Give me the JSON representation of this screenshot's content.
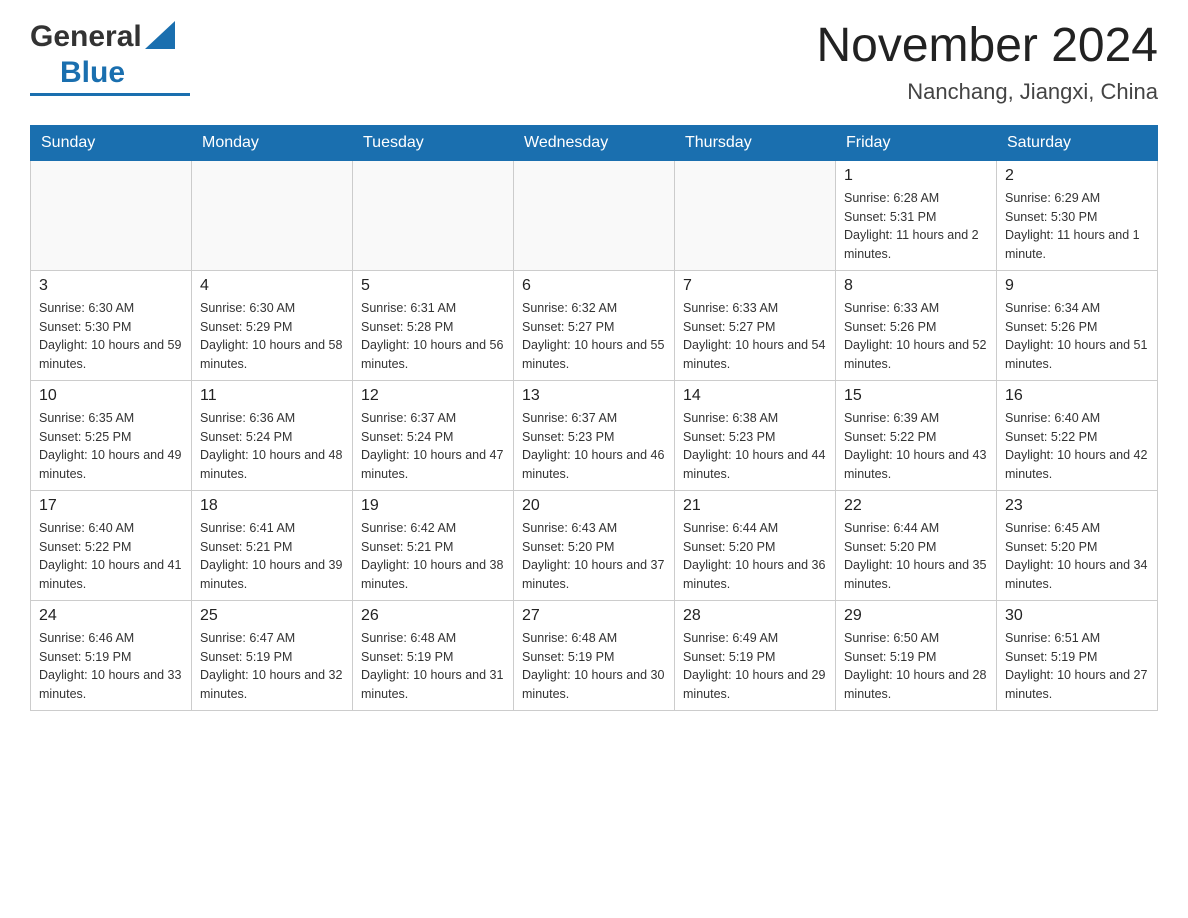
{
  "header": {
    "month_title": "November 2024",
    "location": "Nanchang, Jiangxi, China",
    "logo_general": "General",
    "logo_blue": "Blue"
  },
  "days_of_week": [
    "Sunday",
    "Monday",
    "Tuesday",
    "Wednesday",
    "Thursday",
    "Friday",
    "Saturday"
  ],
  "weeks": [
    [
      {
        "day": "",
        "sunrise": "",
        "sunset": "",
        "daylight": ""
      },
      {
        "day": "",
        "sunrise": "",
        "sunset": "",
        "daylight": ""
      },
      {
        "day": "",
        "sunrise": "",
        "sunset": "",
        "daylight": ""
      },
      {
        "day": "",
        "sunrise": "",
        "sunset": "",
        "daylight": ""
      },
      {
        "day": "",
        "sunrise": "",
        "sunset": "",
        "daylight": ""
      },
      {
        "day": "1",
        "sunrise": "Sunrise: 6:28 AM",
        "sunset": "Sunset: 5:31 PM",
        "daylight": "Daylight: 11 hours and 2 minutes."
      },
      {
        "day": "2",
        "sunrise": "Sunrise: 6:29 AM",
        "sunset": "Sunset: 5:30 PM",
        "daylight": "Daylight: 11 hours and 1 minute."
      }
    ],
    [
      {
        "day": "3",
        "sunrise": "Sunrise: 6:30 AM",
        "sunset": "Sunset: 5:30 PM",
        "daylight": "Daylight: 10 hours and 59 minutes."
      },
      {
        "day": "4",
        "sunrise": "Sunrise: 6:30 AM",
        "sunset": "Sunset: 5:29 PM",
        "daylight": "Daylight: 10 hours and 58 minutes."
      },
      {
        "day": "5",
        "sunrise": "Sunrise: 6:31 AM",
        "sunset": "Sunset: 5:28 PM",
        "daylight": "Daylight: 10 hours and 56 minutes."
      },
      {
        "day": "6",
        "sunrise": "Sunrise: 6:32 AM",
        "sunset": "Sunset: 5:27 PM",
        "daylight": "Daylight: 10 hours and 55 minutes."
      },
      {
        "day": "7",
        "sunrise": "Sunrise: 6:33 AM",
        "sunset": "Sunset: 5:27 PM",
        "daylight": "Daylight: 10 hours and 54 minutes."
      },
      {
        "day": "8",
        "sunrise": "Sunrise: 6:33 AM",
        "sunset": "Sunset: 5:26 PM",
        "daylight": "Daylight: 10 hours and 52 minutes."
      },
      {
        "day": "9",
        "sunrise": "Sunrise: 6:34 AM",
        "sunset": "Sunset: 5:26 PM",
        "daylight": "Daylight: 10 hours and 51 minutes."
      }
    ],
    [
      {
        "day": "10",
        "sunrise": "Sunrise: 6:35 AM",
        "sunset": "Sunset: 5:25 PM",
        "daylight": "Daylight: 10 hours and 49 minutes."
      },
      {
        "day": "11",
        "sunrise": "Sunrise: 6:36 AM",
        "sunset": "Sunset: 5:24 PM",
        "daylight": "Daylight: 10 hours and 48 minutes."
      },
      {
        "day": "12",
        "sunrise": "Sunrise: 6:37 AM",
        "sunset": "Sunset: 5:24 PM",
        "daylight": "Daylight: 10 hours and 47 minutes."
      },
      {
        "day": "13",
        "sunrise": "Sunrise: 6:37 AM",
        "sunset": "Sunset: 5:23 PM",
        "daylight": "Daylight: 10 hours and 46 minutes."
      },
      {
        "day": "14",
        "sunrise": "Sunrise: 6:38 AM",
        "sunset": "Sunset: 5:23 PM",
        "daylight": "Daylight: 10 hours and 44 minutes."
      },
      {
        "day": "15",
        "sunrise": "Sunrise: 6:39 AM",
        "sunset": "Sunset: 5:22 PM",
        "daylight": "Daylight: 10 hours and 43 minutes."
      },
      {
        "day": "16",
        "sunrise": "Sunrise: 6:40 AM",
        "sunset": "Sunset: 5:22 PM",
        "daylight": "Daylight: 10 hours and 42 minutes."
      }
    ],
    [
      {
        "day": "17",
        "sunrise": "Sunrise: 6:40 AM",
        "sunset": "Sunset: 5:22 PM",
        "daylight": "Daylight: 10 hours and 41 minutes."
      },
      {
        "day": "18",
        "sunrise": "Sunrise: 6:41 AM",
        "sunset": "Sunset: 5:21 PM",
        "daylight": "Daylight: 10 hours and 39 minutes."
      },
      {
        "day": "19",
        "sunrise": "Sunrise: 6:42 AM",
        "sunset": "Sunset: 5:21 PM",
        "daylight": "Daylight: 10 hours and 38 minutes."
      },
      {
        "day": "20",
        "sunrise": "Sunrise: 6:43 AM",
        "sunset": "Sunset: 5:20 PM",
        "daylight": "Daylight: 10 hours and 37 minutes."
      },
      {
        "day": "21",
        "sunrise": "Sunrise: 6:44 AM",
        "sunset": "Sunset: 5:20 PM",
        "daylight": "Daylight: 10 hours and 36 minutes."
      },
      {
        "day": "22",
        "sunrise": "Sunrise: 6:44 AM",
        "sunset": "Sunset: 5:20 PM",
        "daylight": "Daylight: 10 hours and 35 minutes."
      },
      {
        "day": "23",
        "sunrise": "Sunrise: 6:45 AM",
        "sunset": "Sunset: 5:20 PM",
        "daylight": "Daylight: 10 hours and 34 minutes."
      }
    ],
    [
      {
        "day": "24",
        "sunrise": "Sunrise: 6:46 AM",
        "sunset": "Sunset: 5:19 PM",
        "daylight": "Daylight: 10 hours and 33 minutes."
      },
      {
        "day": "25",
        "sunrise": "Sunrise: 6:47 AM",
        "sunset": "Sunset: 5:19 PM",
        "daylight": "Daylight: 10 hours and 32 minutes."
      },
      {
        "day": "26",
        "sunrise": "Sunrise: 6:48 AM",
        "sunset": "Sunset: 5:19 PM",
        "daylight": "Daylight: 10 hours and 31 minutes."
      },
      {
        "day": "27",
        "sunrise": "Sunrise: 6:48 AM",
        "sunset": "Sunset: 5:19 PM",
        "daylight": "Daylight: 10 hours and 30 minutes."
      },
      {
        "day": "28",
        "sunrise": "Sunrise: 6:49 AM",
        "sunset": "Sunset: 5:19 PM",
        "daylight": "Daylight: 10 hours and 29 minutes."
      },
      {
        "day": "29",
        "sunrise": "Sunrise: 6:50 AM",
        "sunset": "Sunset: 5:19 PM",
        "daylight": "Daylight: 10 hours and 28 minutes."
      },
      {
        "day": "30",
        "sunrise": "Sunrise: 6:51 AM",
        "sunset": "Sunset: 5:19 PM",
        "daylight": "Daylight: 10 hours and 27 minutes."
      }
    ]
  ]
}
